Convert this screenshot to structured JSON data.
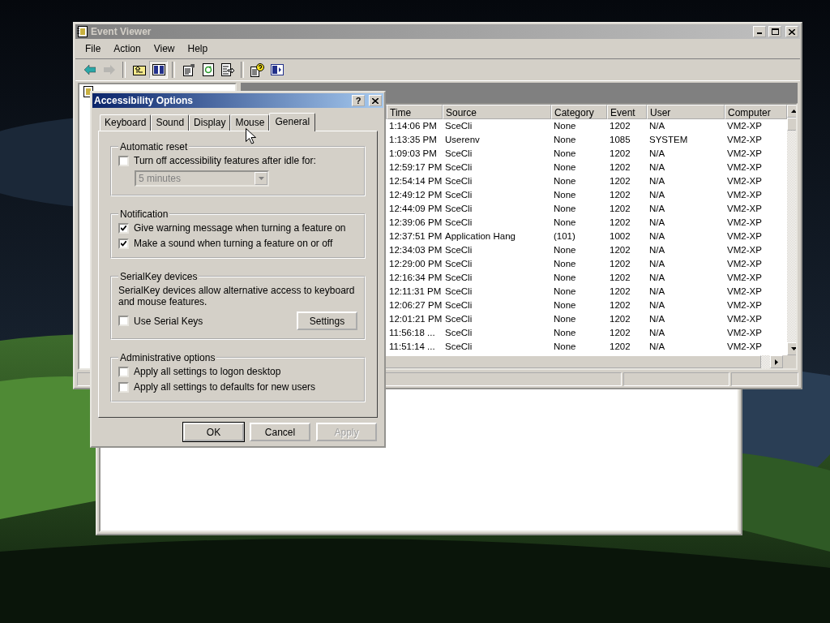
{
  "event_viewer": {
    "title": "Event Viewer",
    "active": false,
    "menu": [
      "File",
      "Action",
      "View",
      "Help"
    ],
    "toolbar": [
      {
        "kind": "back",
        "disabled": false,
        "pressed": false
      },
      {
        "kind": "forward",
        "disabled": true,
        "pressed": false
      },
      {
        "kind": "separator"
      },
      {
        "kind": "up",
        "disabled": false,
        "pressed": false
      },
      {
        "kind": "tree",
        "disabled": false,
        "pressed": true
      },
      {
        "kind": "separator"
      },
      {
        "kind": "properties",
        "disabled": false,
        "pressed": false
      },
      {
        "kind": "refresh",
        "disabled": false,
        "pressed": false
      },
      {
        "kind": "export",
        "disabled": false,
        "pressed": false
      },
      {
        "kind": "separator"
      },
      {
        "kind": "help",
        "disabled": false,
        "pressed": false
      },
      {
        "kind": "pane",
        "disabled": false,
        "pressed": false
      }
    ],
    "table": {
      "columns": [
        "Time",
        "Source",
        "Category",
        "Event",
        "User",
        "Computer"
      ],
      "rows": [
        [
          "1:14:06 PM",
          "SceCli",
          "None",
          "1202",
          "N/A",
          "VM2-XP"
        ],
        [
          "1:13:35 PM",
          "Userenv",
          "None",
          "1085",
          "SYSTEM",
          "VM2-XP"
        ],
        [
          "1:09:03 PM",
          "SceCli",
          "None",
          "1202",
          "N/A",
          "VM2-XP"
        ],
        [
          "12:59:17 PM",
          "SceCli",
          "None",
          "1202",
          "N/A",
          "VM2-XP"
        ],
        [
          "12:54:14 PM",
          "SceCli",
          "None",
          "1202",
          "N/A",
          "VM2-XP"
        ],
        [
          "12:49:12 PM",
          "SceCli",
          "None",
          "1202",
          "N/A",
          "VM2-XP"
        ],
        [
          "12:44:09 PM",
          "SceCli",
          "None",
          "1202",
          "N/A",
          "VM2-XP"
        ],
        [
          "12:39:06 PM",
          "SceCli",
          "None",
          "1202",
          "N/A",
          "VM2-XP"
        ],
        [
          "12:37:51 PM",
          "Application Hang",
          "(101)",
          "1002",
          "N/A",
          "VM2-XP"
        ],
        [
          "12:34:03 PM",
          "SceCli",
          "None",
          "1202",
          "N/A",
          "VM2-XP"
        ],
        [
          "12:29:00 PM",
          "SceCli",
          "None",
          "1202",
          "N/A",
          "VM2-XP"
        ],
        [
          "12:16:34 PM",
          "SceCli",
          "None",
          "1202",
          "N/A",
          "VM2-XP"
        ],
        [
          "12:11:31 PM",
          "SceCli",
          "None",
          "1202",
          "N/A",
          "VM2-XP"
        ],
        [
          "12:06:27 PM",
          "SceCli",
          "None",
          "1202",
          "N/A",
          "VM2-XP"
        ],
        [
          "12:01:21 PM",
          "SceCli",
          "None",
          "1202",
          "N/A",
          "VM2-XP"
        ],
        [
          "11:56:18 ...",
          "SceCli",
          "None",
          "1202",
          "N/A",
          "VM2-XP"
        ],
        [
          "11:51:14 ...",
          "SceCli",
          "None",
          "1202",
          "N/A",
          "VM2-XP"
        ]
      ]
    }
  },
  "dialog": {
    "title": "Accessibility Options",
    "active": true,
    "help_button": "?",
    "tabs": [
      {
        "label": "Keyboard",
        "selected": false
      },
      {
        "label": "Sound",
        "selected": false
      },
      {
        "label": "Display",
        "selected": false
      },
      {
        "label": "Mouse",
        "selected": false
      },
      {
        "label": "General",
        "selected": true
      }
    ],
    "groups": [
      {
        "title": "Automatic reset",
        "items": [
          {
            "kind": "checkbox",
            "label": "Turn off accessibility features after idle for:",
            "checked": false
          },
          {
            "kind": "dropdown",
            "value": "5 minutes",
            "disabled": true
          }
        ]
      },
      {
        "title": "Notification",
        "items": [
          {
            "kind": "checkbox",
            "label": "Give warning message when turning a feature on",
            "checked": true
          },
          {
            "kind": "checkbox",
            "label": "Make a sound when turning a feature on or off",
            "checked": true
          }
        ]
      },
      {
        "title": "SerialKey devices",
        "items": [
          {
            "kind": "text",
            "text": "SerialKey devices allow alternative access to keyboard and mouse features."
          },
          {
            "kind": "checkbox_button",
            "label": "Use Serial Keys",
            "checked": false,
            "button": "Settings"
          }
        ]
      },
      {
        "title": "Administrative options",
        "items": [
          {
            "kind": "checkbox",
            "label": "Apply all settings to logon desktop",
            "checked": false
          },
          {
            "kind": "checkbox",
            "label": "Apply all settings to defaults for new users",
            "checked": false
          }
        ]
      }
    ],
    "buttons": [
      {
        "label": "OK",
        "default": true,
        "disabled": false
      },
      {
        "label": "Cancel",
        "default": false,
        "disabled": false
      },
      {
        "label": "Apply",
        "default": false,
        "disabled": true
      }
    ]
  }
}
